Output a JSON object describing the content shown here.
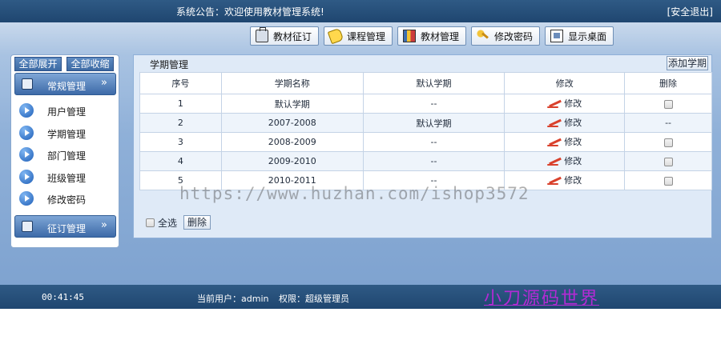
{
  "header": {
    "notice": "系统公告：欢迎使用教材管理系统!",
    "logout_label": "[安全退出]"
  },
  "toolbar": {
    "buttons": [
      {
        "label": "教材征订",
        "icon": "clipboard-icon"
      },
      {
        "label": "课程管理",
        "icon": "tag-icon"
      },
      {
        "label": "教材管理",
        "icon": "books-icon"
      },
      {
        "label": "修改密码",
        "icon": "key-icon"
      },
      {
        "label": "显示桌面",
        "icon": "desktop-icon"
      }
    ]
  },
  "sidebar": {
    "expand_all": "全部展开",
    "collapse_all": "全部收缩",
    "group_routine": "常规管理",
    "group_order": "征订管理",
    "items": [
      {
        "label": "用户管理"
      },
      {
        "label": "学期管理"
      },
      {
        "label": "部门管理"
      },
      {
        "label": "班级管理"
      },
      {
        "label": "修改密码"
      }
    ]
  },
  "main": {
    "title": "学期管理",
    "add_label": "添加学期",
    "columns": [
      "序号",
      "学期名称",
      "默认学期",
      "修改",
      "删除"
    ],
    "rows": [
      {
        "no": "1",
        "name": "默认学期",
        "default": "--",
        "edit": "修改",
        "del": "checkbox"
      },
      {
        "no": "2",
        "name": "2007-2008",
        "default": "默认学期",
        "edit": "修改",
        "del": "--"
      },
      {
        "no": "3",
        "name": "2008-2009",
        "default": "--",
        "edit": "修改",
        "del": "checkbox"
      },
      {
        "no": "4",
        "name": "2009-2010",
        "default": "--",
        "edit": "修改",
        "del": "checkbox"
      },
      {
        "no": "5",
        "name": "2010-2011",
        "default": "--",
        "edit": "修改",
        "del": "checkbox"
      }
    ],
    "select_all_label": "全选",
    "delete_label": "删除"
  },
  "watermark": "https://www.huzhan.com/ishop3572",
  "status": {
    "time": "00:41:45",
    "current_user": "当前用户：admin",
    "role": "权限：超级管理员"
  },
  "brand": "小刀源码世界",
  "colors": {
    "bar": "#1f4670",
    "accent": "#3d6aa8",
    "brand": "#b22bd4"
  }
}
